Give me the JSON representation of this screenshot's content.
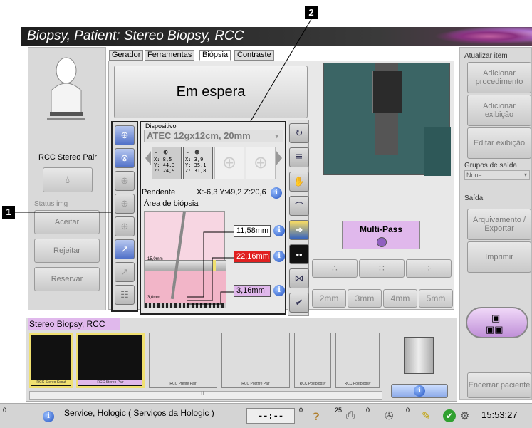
{
  "window": {
    "title": "Biopsy, Patient:  Stereo Biopsy, RCC"
  },
  "left": {
    "image_name": "RCC Stereo Pair",
    "status_label": "Status img",
    "buttons": {
      "accept": "Aceitar",
      "reject": "Rejeitar",
      "reserve": "Reservar"
    }
  },
  "tabs": [
    {
      "label": "Gerador"
    },
    {
      "label": "Ferramentas"
    },
    {
      "label": "Biópsia"
    },
    {
      "label": "Contraste"
    }
  ],
  "standby": "Em espera",
  "device": {
    "section_label": "Dispositivo",
    "selected": "ATEC 12gx12cm, 20mm",
    "targets": [
      {
        "x": "X: 8,5",
        "y": "Y: 44,3",
        "z": "Z: 24,9"
      },
      {
        "x": "X: 3,9",
        "y": "Y: 35,1",
        "z": "Z: 31,8"
      }
    ],
    "pending_label": "Pendente",
    "pending_value": "X:-6,3 Y:49,2 Z:20,6",
    "area_label": "Área de biópsia",
    "bar_label": "15,0mm",
    "bottom_label": "3,0mm",
    "measures": [
      "11,58mm",
      "22,16mm",
      "3,16mm"
    ]
  },
  "multipass": {
    "label": "Multi-Pass"
  },
  "needle_lengths": [
    "2mm",
    "3mm",
    "4mm",
    "5mm"
  ],
  "right": {
    "update_header": "Atualizar item",
    "add_procedure": "Adicionar procedimento",
    "add_view": "Adicionar exibição",
    "edit_view": "Editar exibição",
    "output_groups_header": "Grupos de saída",
    "output_group_value": "None",
    "output_header": "Saída",
    "archive": "Arquivamento / Exportar",
    "print": "Imprimir",
    "close_patient": "Encerrar paciente"
  },
  "strip": {
    "title": "Stereo Biopsy, RCC",
    "thumbs": [
      "RCC Stereo Scout",
      "RCC Stereo Pair",
      "RCC Prefire Pair",
      "RCC Postfire Pair",
      "RCC Postbiopsy",
      "RCC Postbiopsy"
    ],
    "scroll_mark": "II"
  },
  "callouts": [
    "1",
    "2"
  ],
  "statusbar": {
    "left_num": "0",
    "service_text": "Service, Hologic ( Serviços da Hologic )",
    "timer": "--:--",
    "count1": "0",
    "count2": "25",
    "count3": "0",
    "count4": "0",
    "clock": "15:53:27"
  },
  "colors": {
    "accent_blue": "#2050c0",
    "red_measure": "#e02020",
    "multipass": "#e0b8ec",
    "titlebar": "#1e1e1e"
  }
}
